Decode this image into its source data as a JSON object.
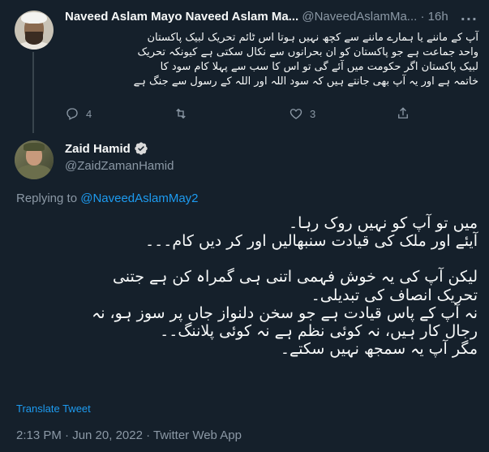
{
  "reply_tweet": {
    "author_name": "Naveed Aslam Mayo Naveed Aslam Ma...",
    "author_handle": "@NaveedAslamMa...",
    "separator": "·",
    "time": "16h",
    "more_icon": "more-horizontal-icon",
    "body_lines": [
      "آپ کے ماننے یا ہمارے ماننے سے کچھ نہیں ہوتا اس ٹائم تحریک لبیک پاکستان",
      "واحد جماعت ہے جو پاکستان کو ان بحرانوں سے نکال سکتی ہے کیونکہ تحریک",
      "لبیک پاکستان اگر حکومت میں آئے گی تو اس کا سب سے پہلا کام سود کا",
      "خاتمہ ہے اور یہ آپ بھی جانتے ہیں کہ سود اللہ اور اللہ کے رسول سے جنگ ہے"
    ],
    "actions": {
      "reply_count": "4",
      "retweet_count": "",
      "like_count": "3"
    }
  },
  "main_tweet": {
    "author_name": "Zaid Hamid",
    "author_handle": "@ZaidZamanHamid",
    "verified_icon": "verified-badge-icon",
    "replying_prefix": "Replying to",
    "replying_handle": "@NaveedAslamMay2",
    "body_lines": [
      "میں تو آپ کو نہیں روک رہا۔",
      "آیئے اور ملک کی قیادت سنبھالیں اور کر دیں کام۔۔۔",
      "",
      "لیکن آپ کی یہ خوش فہمی اتنی ہی گمراہ کن ہے جتنی",
      "تحریک انصاف کی تبدیلی۔",
      "نہ آپ کے پاس قیادت ہے جو سخن دلنواز جاں پر سوز ہو، نہ",
      "رجال کار ہیں، نہ کوئی نظم ہے نہ کوئی پلاننگ۔۔",
      "مگر آپ یہ سمجھ نہیں سکتے۔"
    ],
    "translate_label": "Translate Tweet",
    "timestamp": "2:13 PM · Jun 20, 2022 · Twitter Web App"
  },
  "colors": {
    "background": "#15202b",
    "text": "#f7f9f9",
    "muted": "#8b98a5",
    "accent": "#1d9bf0",
    "divider": "#38444d"
  }
}
